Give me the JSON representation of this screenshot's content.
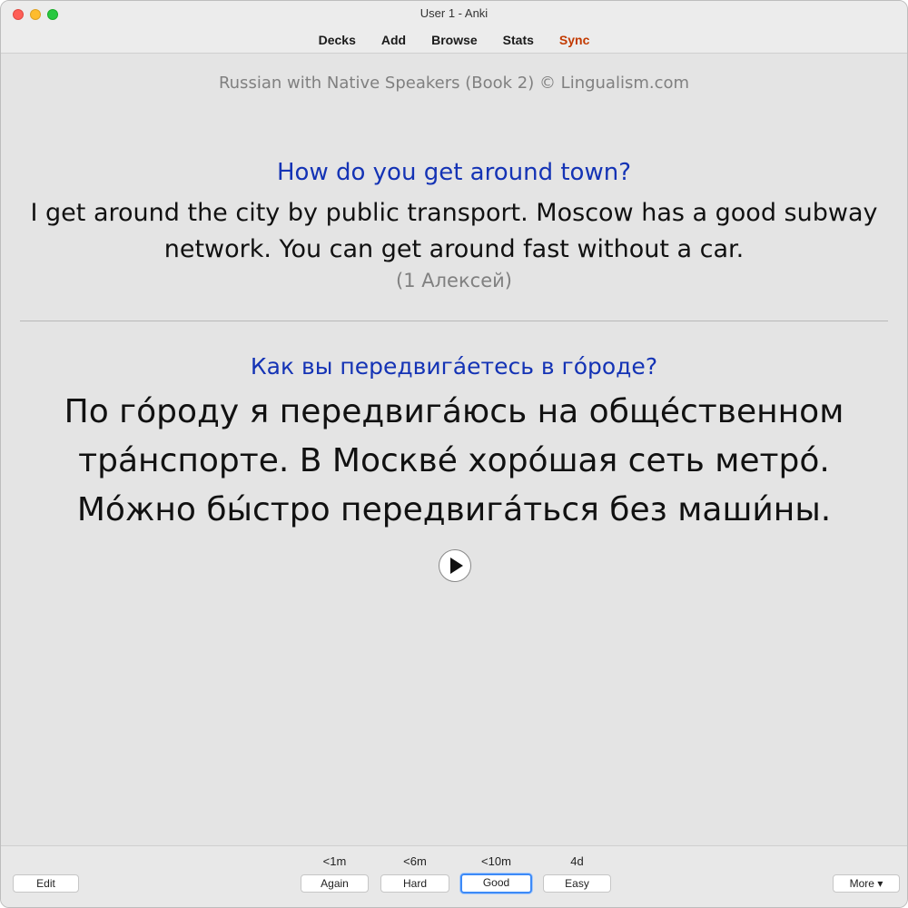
{
  "window": {
    "title": "User 1 - Anki"
  },
  "menu": {
    "items": [
      "Decks",
      "Add",
      "Browse",
      "Stats",
      "Sync"
    ]
  },
  "card": {
    "deck_credit": "Russian with Native Speakers (Book 2) © Lingualism.com",
    "question_en": "How do you get around town?",
    "answer_en": "I get around the city by public transport. Moscow has a good subway network. You can get around fast without a car.",
    "speaker": "(1 Алексей)",
    "question_ru": "Как вы передвига́етесь в го́роде?",
    "answer_ru": "По го́роду я передвига́юсь на обще́ственном тра́нспорте. В Москве́ хоро́шая сеть метро́. Мо́жно бы́стро передвига́ться без маши́ны.",
    "audio_icon": "play-icon"
  },
  "review": {
    "edit_label": "Edit",
    "more_label": "More ▾",
    "answers": [
      {
        "label": "Again",
        "interval": "<1m"
      },
      {
        "label": "Hard",
        "interval": "<6m"
      },
      {
        "label": "Good",
        "interval": "<10m",
        "default": true
      },
      {
        "label": "Easy",
        "interval": "4d"
      }
    ]
  },
  "colors": {
    "question_accent": "#1433b5",
    "sync_accent": "#c23a00",
    "focus_ring": "#3d8af7"
  }
}
